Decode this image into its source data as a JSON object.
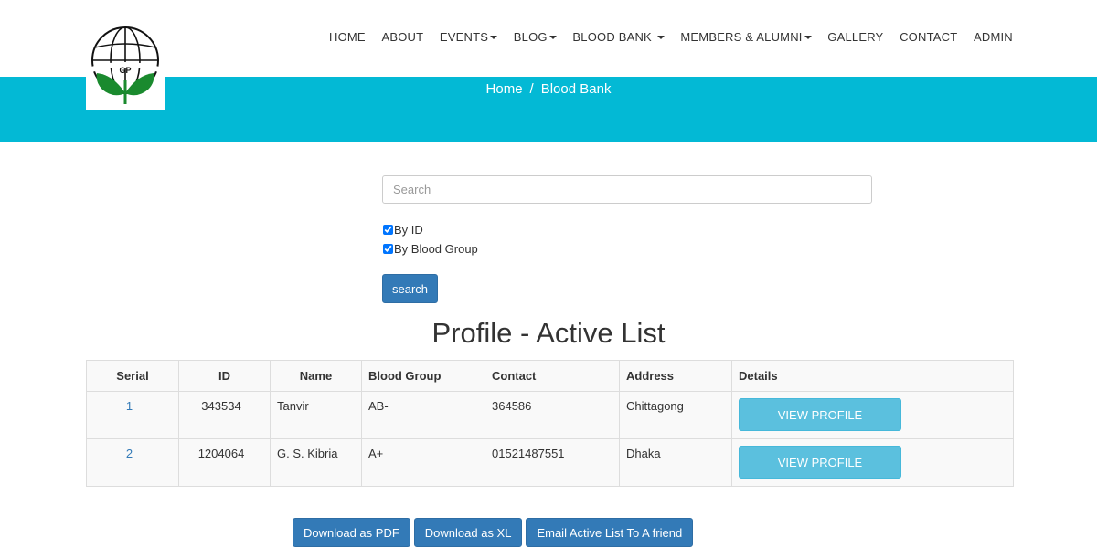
{
  "logo": {
    "text": "GP",
    "name": "gp-logo"
  },
  "nav": {
    "items": [
      {
        "label": "HOME",
        "dropdown": false
      },
      {
        "label": "ABOUT",
        "dropdown": false
      },
      {
        "label": "EVENTS",
        "dropdown": true
      },
      {
        "label": "BLOG",
        "dropdown": true
      },
      {
        "label": "BLOOD BANK",
        "dropdown": true
      },
      {
        "label": "MEMBERS & ALUMNI",
        "dropdown": true
      },
      {
        "label": "GALLERY",
        "dropdown": false
      },
      {
        "label": "CONTACT",
        "dropdown": false
      },
      {
        "label": "ADMIN",
        "dropdown": false
      }
    ]
  },
  "breadcrumb": {
    "home": "Home",
    "separator": "/",
    "current": "Blood Bank"
  },
  "search": {
    "placeholder": "Search",
    "value": "",
    "by_id_label": "By ID",
    "by_id_checked": true,
    "by_blood_group_label": "By Blood Group",
    "by_blood_group_checked": true,
    "button_label": "search"
  },
  "title": "Profile - Active List",
  "table": {
    "headers": [
      "Serial",
      "ID",
      "Name",
      "Blood Group",
      "Contact",
      "Address",
      "Details"
    ],
    "rows": [
      {
        "serial": "1",
        "id": "343534",
        "name": "Tanvir",
        "blood_group": "AB-",
        "contact": "364586",
        "address": "Chittagong",
        "action": "VIEW PROFILE"
      },
      {
        "serial": "2",
        "id": "1204064",
        "name": "G. S. Kibria",
        "blood_group": "A+",
        "contact": "01521487551",
        "address": "Dhaka",
        "action": "VIEW PROFILE"
      }
    ]
  },
  "actions": {
    "download_pdf": "Download as PDF",
    "download_xl": "Download as XL",
    "email_list": "Email Active List To A friend"
  },
  "colors": {
    "banner": "#03b9d5",
    "primary": "#337ab7",
    "info": "#5bc0de",
    "logo_green": "#1a8a2e"
  }
}
